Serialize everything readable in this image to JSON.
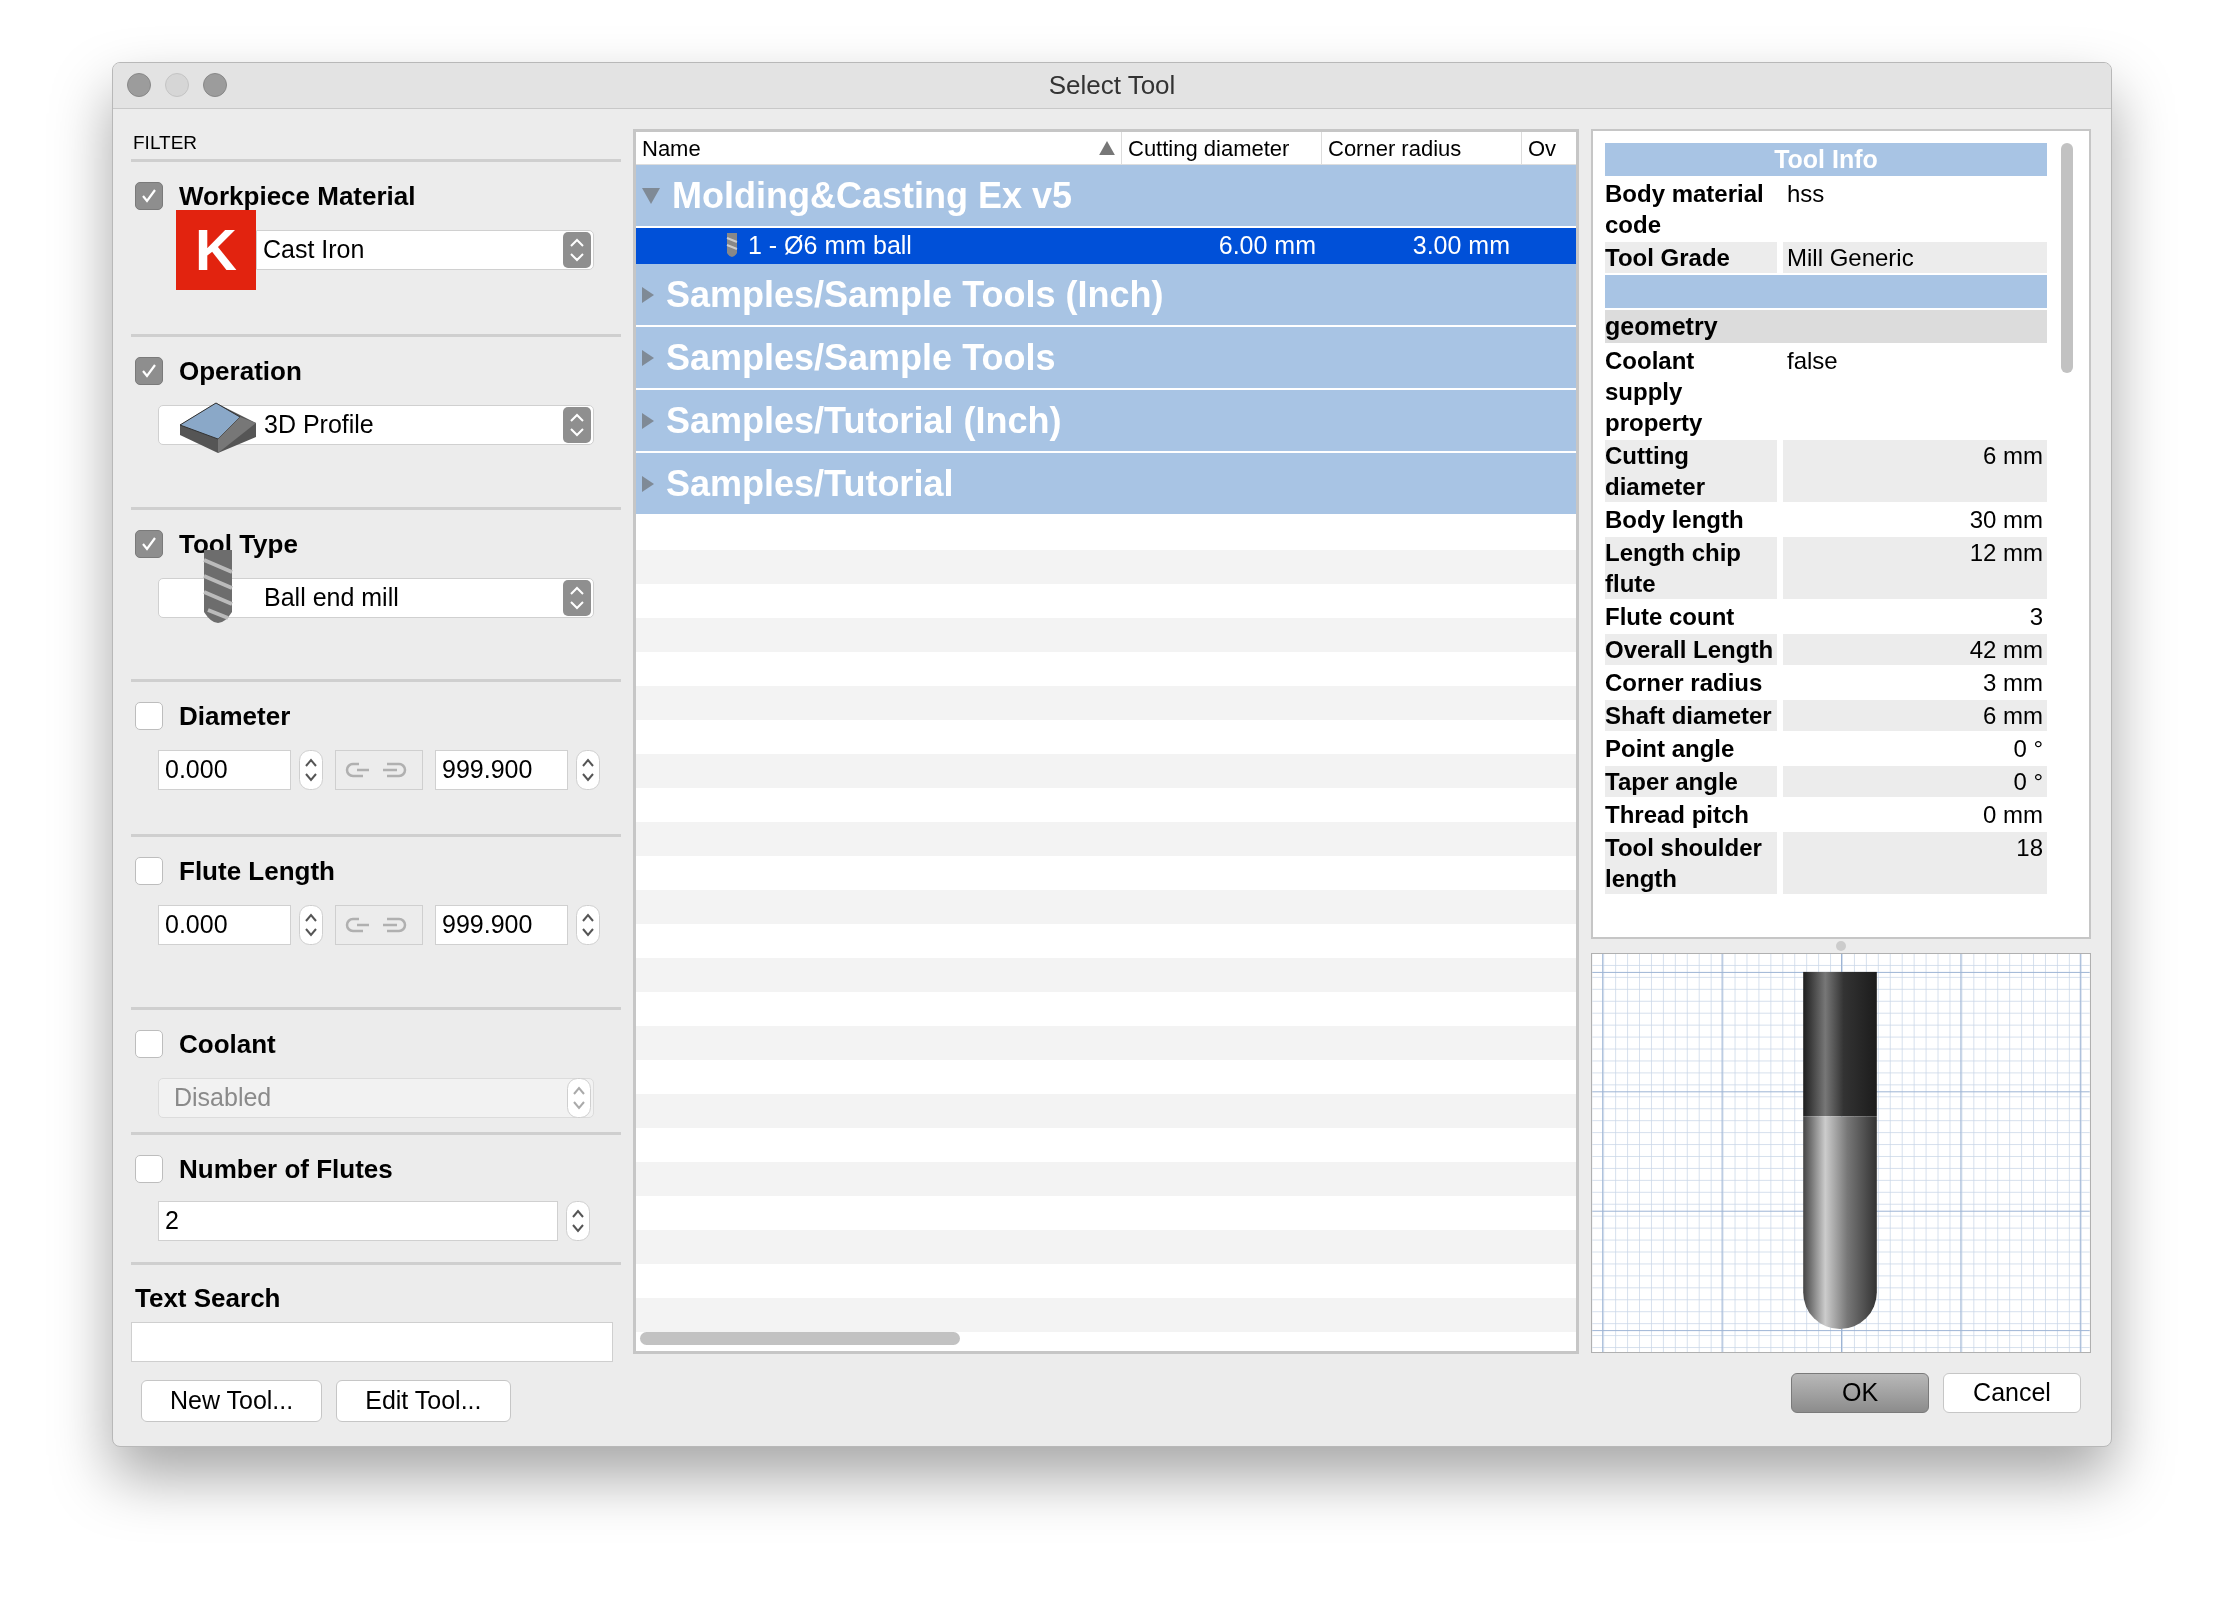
{
  "window": {
    "title": "Select Tool"
  },
  "filter": {
    "heading": "FILTER",
    "sections": [
      {
        "kind": "dropdown",
        "label": "Workpiece Material",
        "checked": true,
        "value": "Cast Iron",
        "badge": "K",
        "disabled": false
      },
      {
        "kind": "dropdown",
        "label": "Operation",
        "checked": true,
        "value": "3D Profile",
        "disabled": false
      },
      {
        "kind": "dropdown",
        "label": "Tool Type",
        "checked": true,
        "value": "Ball end mill",
        "disabled": false
      },
      {
        "kind": "range",
        "label": "Diameter",
        "checked": false,
        "min": "0.000",
        "max": "999.900"
      },
      {
        "kind": "range",
        "label": "Flute Length",
        "checked": false,
        "min": "0.000",
        "max": "999.900"
      },
      {
        "kind": "dropdown",
        "label": "Coolant",
        "checked": false,
        "value": "Disabled",
        "disabled": true
      },
      {
        "kind": "number",
        "label": "Number of Flutes",
        "checked": false,
        "value": "2"
      }
    ],
    "search": {
      "label": "Text Search"
    }
  },
  "tool_list": {
    "columns": [
      {
        "label": "Name",
        "sorted": true
      },
      {
        "label": "Cutting diameter",
        "sorted": false
      },
      {
        "label": "Corner radius",
        "sorted": false
      },
      {
        "label": "Ov",
        "sorted": false
      }
    ],
    "groups": [
      {
        "name": "Molding&Casting Ex v5",
        "expanded": true,
        "children": [
          {
            "name": "1 - Ø6 mm ball",
            "cutting_diameter": "6.00 mm",
            "corner_radius": "3.00 mm",
            "selected": true
          }
        ]
      },
      {
        "name": "Samples/Sample Tools (Inch)",
        "expanded": false
      },
      {
        "name": "Samples/Sample Tools",
        "expanded": false
      },
      {
        "name": "Samples/Tutorial (Inch)",
        "expanded": false
      },
      {
        "name": "Samples/Tutorial",
        "expanded": false
      }
    ]
  },
  "tool_info": {
    "title": "Tool Info",
    "rows": [
      {
        "kind": "text",
        "label": "Body material code",
        "value": "hss"
      },
      {
        "kind": "text",
        "label": "Tool Grade",
        "value": "Mill Generic"
      },
      {
        "kind": "band"
      },
      {
        "kind": "section",
        "label": "geometry"
      },
      {
        "kind": "text",
        "label": "Coolant supply property",
        "value": "false"
      },
      {
        "kind": "number",
        "label": "Cutting diameter",
        "value": "6 mm"
      },
      {
        "kind": "number",
        "label": "Body length",
        "value": "30 mm"
      },
      {
        "kind": "number",
        "label": "Length chip flute",
        "value": "12 mm"
      },
      {
        "kind": "number",
        "label": "Flute count",
        "value": "3"
      },
      {
        "kind": "number",
        "label": "Overall Length",
        "value": "42 mm"
      },
      {
        "kind": "number",
        "label": "Corner radius",
        "value": "3 mm"
      },
      {
        "kind": "number",
        "label": "Shaft diameter",
        "value": "6 mm"
      },
      {
        "kind": "number",
        "label": "Point angle",
        "value": "0 °"
      },
      {
        "kind": "number",
        "label": "Taper angle",
        "value": "0 °"
      },
      {
        "kind": "number",
        "label": "Thread pitch",
        "value": "0 mm"
      },
      {
        "kind": "number",
        "label": "Tool shoulder length",
        "value": "18"
      }
    ]
  },
  "left_buttons": [
    {
      "label": "New Tool..."
    },
    {
      "label": "Edit Tool..."
    }
  ],
  "dialog_buttons": [
    {
      "label": "OK",
      "default": true
    },
    {
      "label": "Cancel",
      "default": false
    }
  ]
}
